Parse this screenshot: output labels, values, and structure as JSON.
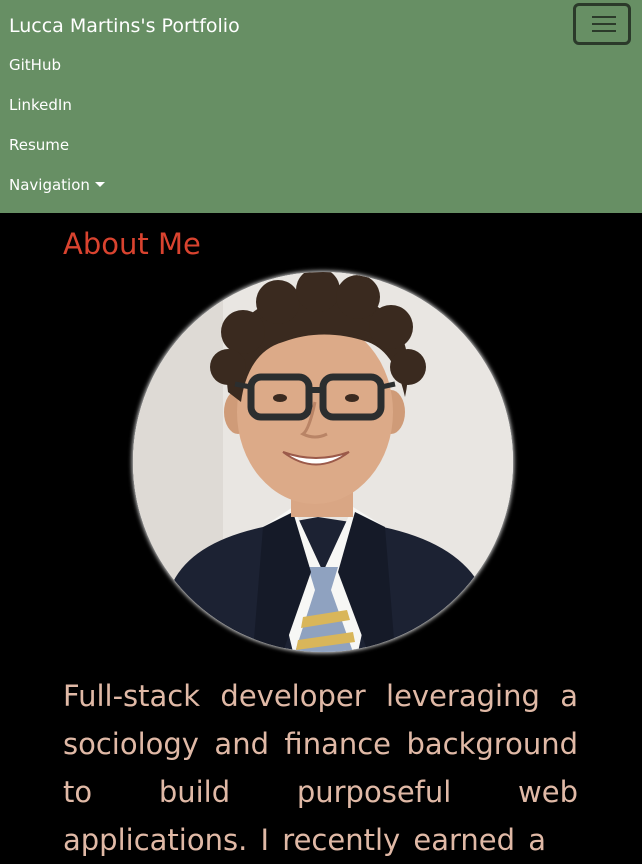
{
  "navbar": {
    "brand": "Lucca Martins's Portfolio",
    "toggle_icon": "hamburger-menu-icon",
    "links": [
      {
        "label": "GitHub"
      },
      {
        "label": "LinkedIn"
      },
      {
        "label": "Resume"
      },
      {
        "label": "Navigation",
        "has_dropdown": true
      }
    ],
    "background_color": "#678f64"
  },
  "about": {
    "heading": "About Me",
    "heading_color": "#d9432f",
    "intro": "Full-stack developer leveraging a sociology and finance background to build purposeful web applications. I recently earned a",
    "intro_color": "#e0b9a6"
  }
}
